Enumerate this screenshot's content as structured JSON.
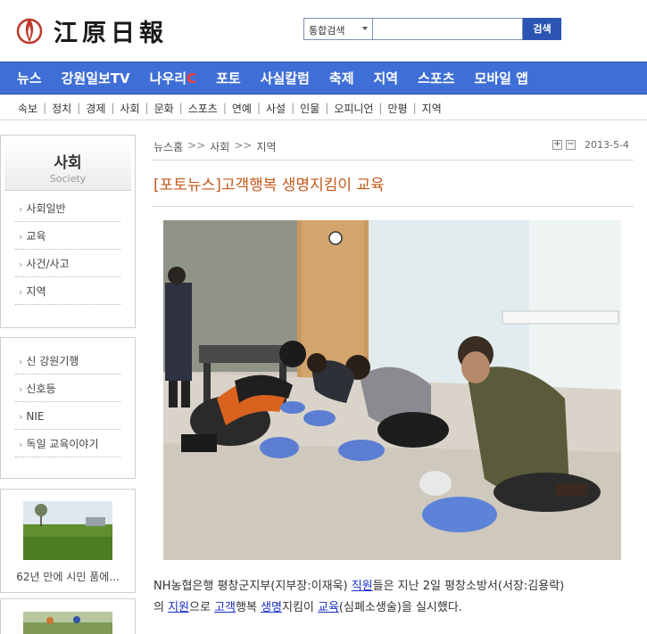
{
  "header": {
    "logo_text": "江原日報",
    "search": {
      "scope": "통합검색",
      "button": "검색"
    }
  },
  "gnb": {
    "items": [
      "뉴스",
      "강원일보TV",
      "나우리",
      "포토",
      "사실칼럼",
      "축제",
      "지역",
      "스포츠",
      "모바일 앱"
    ],
    "nauri_suffix": "C"
  },
  "lnb": {
    "items": [
      "속보",
      "정치",
      "경제",
      "사회",
      "문화",
      "스포츠",
      "연예",
      "사설",
      "인물",
      "오피니언",
      "만평",
      "지역"
    ]
  },
  "sidebar": {
    "section_title": "사회",
    "section_title_en": "Society",
    "menu": [
      "사회일반",
      "교육",
      "사건/사고",
      "지역"
    ],
    "series": [
      "신 강원기행",
      "신호등",
      "NIE",
      "독일 교육이야기"
    ],
    "thumb_caption": "62년 만에 시민 품에..."
  },
  "article": {
    "breadcrumb": [
      "뉴스홈",
      "사회",
      "지역"
    ],
    "date": "2013-5-4",
    "zoom_in": "+",
    "zoom_out": "−",
    "title": "[포토뉴스]고객행복 생명지킴이 교육",
    "body": {
      "p1": "NH농협은행 평창군지부(지부장:이재욱) ",
      "l1": "직원",
      "p2": "들은 지난 2일 평창소방서(서장:김용락)",
      "p3": "의 ",
      "l2": "지원",
      "p4": "으로 ",
      "l3": "고객",
      "p5": "행복 ",
      "l4": "생명",
      "p6": "지킴이 ",
      "l5": "교육",
      "p7": "(심폐소생술)을 실시했다."
    }
  },
  "colors": {
    "nav_blue": "#3f6fd6",
    "headline_orange": "#c4581a",
    "link_blue": "#1a2fc4"
  }
}
